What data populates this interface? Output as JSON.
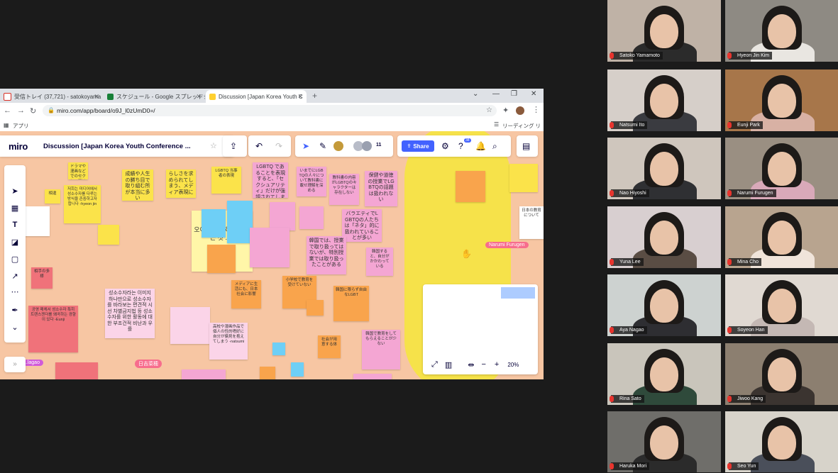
{
  "browser": {
    "tabs": [
      {
        "label": "受信トレイ (37,721) - satokoyama",
        "icon": "gmail-icon",
        "color": "#d93025"
      },
      {
        "label": "スケジュール - Google スプレッドシート",
        "icon": "sheets-icon",
        "color": "#188038"
      },
      {
        "label": "Discussion [Japan Korea Youth C",
        "icon": "miro-icon",
        "color": "#ffd02f"
      }
    ],
    "new_tab": "+",
    "url": "miro.com/app/board/o9J_l0zUmD0=/",
    "bookmark_apps": "アプリ",
    "reading_list": "リーディング リスト"
  },
  "miro": {
    "logo": "miro",
    "board_title": "Discussion [Japan Korea Youth Conference ...",
    "share": "Share",
    "collaborators_count": "11",
    "notifications_badge": "38",
    "zoom": "20%",
    "cursors": [
      {
        "name": "Narumi Furugen",
        "color": "#f76d8d"
      },
      {
        "name": "日吉菜穂",
        "color": "#f76d8d"
      },
      {
        "name": "...lagao",
        "color": "#d15ad9"
      }
    ],
    "notes": [
      {
        "text": "ドラマや漫画などでのセクシュアリティ",
        "color": "ylw"
      },
      {
        "text": "相違",
        "color": "ylw"
      },
      {
        "text": "저희는 미디어에서 성소수자를 다루는 방식을 존중하고자 합니다 -hyeon jin",
        "color": "ylw"
      },
      {
        "text": "成績や人生の勝ち目で取り組む所が本当に多い",
        "color": "ylw"
      },
      {
        "text": "らしさを求められてしまう、メディア表現に",
        "color": "ylw"
      },
      {
        "text": "LGBTQ 当事者の表現",
        "color": "ylw"
      },
      {
        "text": "LGBTQ であることを表現すると、「セクシュアリティ」だけが強調されてしまう",
        "color": "pnk"
      },
      {
        "text": "いまでにLGBTQの人々について教科書に載せ理解を深める",
        "color": "pnk"
      },
      {
        "text": "教科書の内容がLGBTQのキャラクターは存在しない",
        "color": "pnk"
      },
      {
        "text": "保健や道徳の授業でLGBTQの話題は扱われない",
        "color": "pnk"
      },
      {
        "text": "バラエティでLGBTQの人たちは「ネタ」的に扱われていることが多い",
        "color": "pnk"
      },
      {
        "text": "韓国では、授業で取り扱ってはないが、特別授業では取り扱ったことがある",
        "color": "pnk"
      },
      {
        "text": "韓国すると、自分がかかわっている",
        "color": "pnk"
      },
      {
        "text": "성소수자라는 이미지 하나만으로 성소수자를 바라보는 편견적 시선 차별금지법 등 성소수자를 위한 활동에 대한 부조건적 비난과 우를",
        "color": "lpk"
      },
      {
        "text": "高校や漫画作品で個人の性的嗜好に自分が偏見を抱えてしまう -natsumi",
        "color": "lpk"
      },
      {
        "text": "공영 매체서 성소수자 특히 트랜스젠더를 왜곡하는 경향이 있다 -Eunji",
        "color": "red"
      },
      {
        "text": "相手の多様",
        "color": "red"
      },
      {
        "text": "メディアに生活にも、日本社会に影響",
        "color": "org"
      },
      {
        "text": "小学校で教育を受けていない",
        "color": "org"
      },
      {
        "text": "韓国に限らず自由なLGBT",
        "color": "org"
      },
      {
        "text": "社会が用意する体",
        "color": "org"
      },
      {
        "text": "日本の教育について",
        "color": "wht"
      },
      {
        "text": "韓国で教育をしてもらえることが少ない",
        "color": "pnk"
      }
    ]
  },
  "participants": [
    {
      "name": "Satoko Yamamoto"
    },
    {
      "name": "Hyeon Jin Kim"
    },
    {
      "name": "Natsumi Ito"
    },
    {
      "name": "Eunji Park"
    },
    {
      "name": "Nao Hiyoshi"
    },
    {
      "name": "Narumi Furugen"
    },
    {
      "name": "Yuna Lee"
    },
    {
      "name": "Mina Cho"
    },
    {
      "name": "Aya Nagao"
    },
    {
      "name": "Soyeon Han"
    },
    {
      "name": "Rina Sato"
    },
    {
      "name": "Jiwoo Kang"
    },
    {
      "name": "Haruka Mori"
    },
    {
      "name": "Seo Yun"
    }
  ]
}
